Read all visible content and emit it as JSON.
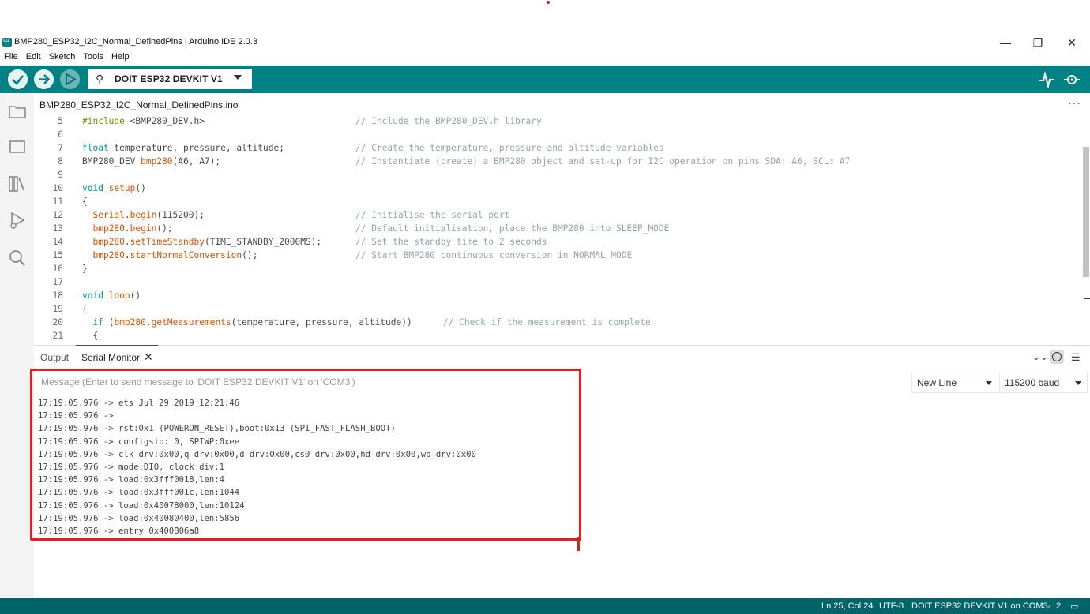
{
  "window": {
    "title": "BMP280_ESP32_I2C_Normal_DefinedPins | Arduino IDE 2.0.3",
    "controls": {
      "minimize": "—",
      "maximize": "❐",
      "close": "✕"
    }
  },
  "menu": [
    "File",
    "Edit",
    "Sketch",
    "Tools",
    "Help"
  ],
  "toolbar": {
    "board": "DOIT ESP32 DEVKIT V1",
    "icons": [
      "verify-icon",
      "upload-icon",
      "debug-icon",
      "serial-plotter-icon",
      "serial-monitor-icon"
    ]
  },
  "activity_icons": [
    "sketchbook-icon",
    "boards-manager-icon",
    "library-manager-icon",
    "debug-icon",
    "search-icon"
  ],
  "editor": {
    "tab": "BMP280_ESP32_I2C_Normal_DefinedPins.ino",
    "lines": [
      {
        "n": "5",
        "code": "#include <BMP280_DEV.h>",
        "comment": "// Include the BMP280_DEV.h library"
      },
      {
        "n": "6",
        "code": "",
        "comment": ""
      },
      {
        "n": "7",
        "code": "float temperature, pressure, altitude;",
        "comment": "// Create the temperature, pressure and altitude variables"
      },
      {
        "n": "8",
        "code": "BMP280_DEV bmp280(A6, A7);",
        "comment": "// Instantiate (create) a BMP280 object and set-up for I2C operation on pins SDA: A6, SCL: A7"
      },
      {
        "n": "9",
        "code": "",
        "comment": ""
      },
      {
        "n": "10",
        "code": "void setup()",
        "comment": ""
      },
      {
        "n": "11",
        "code": "{",
        "comment": ""
      },
      {
        "n": "12",
        "code": "  Serial.begin(115200);",
        "comment": "// Initialise the serial port"
      },
      {
        "n": "13",
        "code": "  bmp280.begin();",
        "comment": "// Default initialisation, place the BMP280 into SLEEP_MODE"
      },
      {
        "n": "14",
        "code": "  bmp280.setTimeStandby(TIME_STANDBY_2000MS);",
        "comment": "// Set the standby time to 2 seconds"
      },
      {
        "n": "15",
        "code": "  bmp280.startNormalConversion();",
        "comment": "// Start BMP280 continuous conversion in NORMAL_MODE"
      },
      {
        "n": "16",
        "code": "}",
        "comment": ""
      },
      {
        "n": "17",
        "code": "",
        "comment": ""
      },
      {
        "n": "18",
        "code": "void loop()",
        "comment": ""
      },
      {
        "n": "19",
        "code": "{",
        "comment": ""
      },
      {
        "n": "20",
        "code": "  if (bmp280.getMeasurements(temperature, pressure, altitude))",
        "comment": "// Check if the measurement is complete"
      },
      {
        "n": "21",
        "code": "  {",
        "comment": ""
      }
    ]
  },
  "panel": {
    "tabs": {
      "output": "Output",
      "serial": "Serial Monitor",
      "close": "✕"
    },
    "message_placeholder": "Message (Enter to send message to 'DOIT ESP32 DEVKIT V1' on 'COM3')",
    "line_ending": "New Line",
    "baud": "115200 baud",
    "serial_lines": [
      "17:19:05.976 -> ets Jul 29 2019 12:21:46",
      "17:19:05.976 -> ",
      "17:19:05.976 -> rst:0x1 (POWERON_RESET),boot:0x13 (SPI_FAST_FLASH_BOOT)",
      "17:19:05.976 -> configsip: 0, SPIWP:0xee",
      "17:19:05.976 -> clk_drv:0x00,q_drv:0x00,d_drv:0x00,cs0_drv:0x00,hd_drv:0x00,wp_drv:0x00",
      "17:19:05.976 -> mode:DIO, clock div:1",
      "17:19:05.976 -> load:0x3fff0018,len:4",
      "17:19:05.976 -> load:0x3fff001c,len:1044",
      "17:19:05.976 -> load:0x40078000,len:10124",
      "17:19:05.976 -> load:0x40080400,len:5856",
      "17:19:05.976 -> entry 0x400806a8"
    ]
  },
  "status": {
    "position": "Ln 25, Col 24",
    "encoding": "UTF-8",
    "board_port": "DOIT ESP32 DEVKIT V1 on COM3",
    "notifications": "2"
  },
  "colors": {
    "teal": "#008184",
    "status": "#006468",
    "annotation": "#e0201e"
  }
}
